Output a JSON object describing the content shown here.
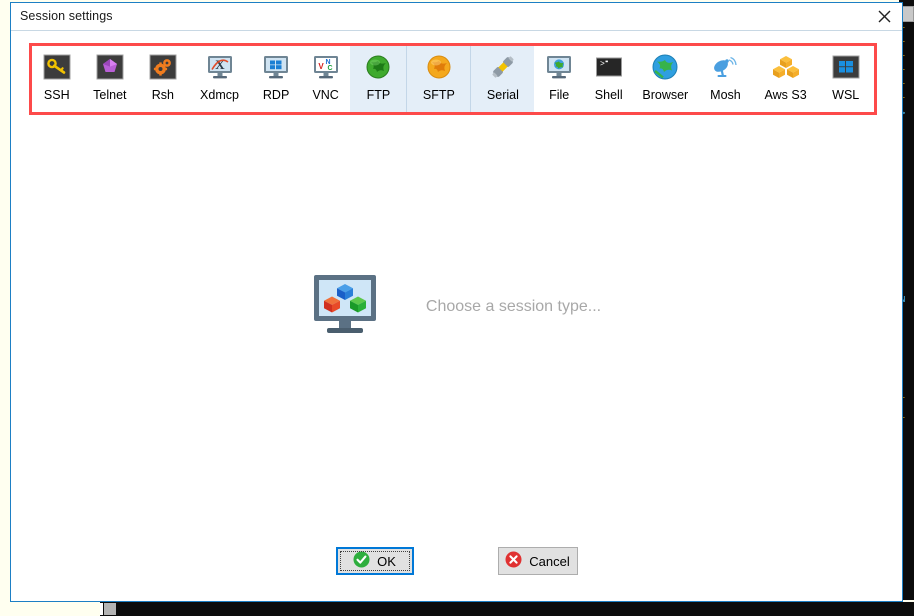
{
  "window": {
    "title": "Session settings",
    "close_icon": "close-icon",
    "border_color": "#1d7fc4",
    "background": "#ffffff"
  },
  "annotation": {
    "color": "#fd4a4a",
    "shape": "rectangle",
    "target": "session-type-toolbar"
  },
  "toolbar": {
    "highlight_color": "#e4eef8",
    "items": [
      {
        "label": "SSH",
        "icon": "ssh-key-icon",
        "highlighted": false
      },
      {
        "label": "Telnet",
        "icon": "telnet-gem-icon",
        "highlighted": false
      },
      {
        "label": "Rsh",
        "icon": "rsh-gears-icon",
        "highlighted": false
      },
      {
        "label": "Xdmcp",
        "icon": "xdmcp-monitor-icon",
        "highlighted": false
      },
      {
        "label": "RDP",
        "icon": "rdp-monitor-icon",
        "highlighted": false
      },
      {
        "label": "VNC",
        "icon": "vnc-monitor-icon",
        "highlighted": false
      },
      {
        "label": "FTP",
        "icon": "ftp-green-globe-icon",
        "highlighted": true
      },
      {
        "label": "SFTP",
        "icon": "sftp-orange-globe-icon",
        "highlighted": true
      },
      {
        "label": "Serial",
        "icon": "serial-plug-icon",
        "highlighted": true
      },
      {
        "label": "File",
        "icon": "file-monitor-globe-icon",
        "highlighted": false
      },
      {
        "label": "Shell",
        "icon": "shell-terminal-icon",
        "highlighted": false
      },
      {
        "label": "Browser",
        "icon": "browser-globe-icon",
        "highlighted": false
      },
      {
        "label": "Mosh",
        "icon": "mosh-satellite-icon",
        "highlighted": false
      },
      {
        "label": "Aws S3",
        "icon": "aws-s3-cubes-icon",
        "highlighted": false
      },
      {
        "label": "WSL",
        "icon": "wsl-windows-icon",
        "highlighted": false
      }
    ]
  },
  "main": {
    "placeholder_text": "Choose a session type...",
    "placeholder_icon": "monitor-cubes-icon",
    "placeholder_text_color": "#a8a8a8"
  },
  "footer": {
    "ok_label": "OK",
    "ok_icon": "green-check-circle-icon",
    "ok_focused": true,
    "cancel_label": "Cancel",
    "cancel_icon": "red-x-circle-icon"
  },
  "background_window": {
    "type": "terminal",
    "color": "#0c0c0c"
  }
}
